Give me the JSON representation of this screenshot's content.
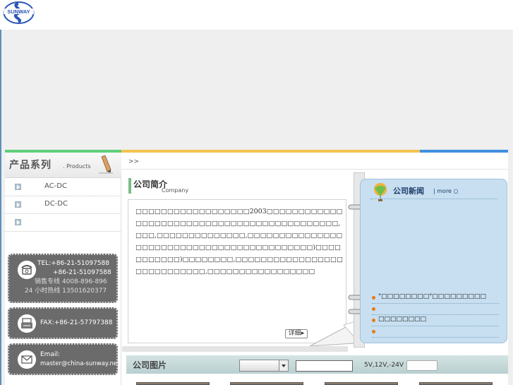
{
  "brand": {
    "logo_text": "SUNWAY"
  },
  "sidebar": {
    "title_cn": "产品系列",
    "title_en": ". Products",
    "items": [
      {
        "label": "AC-DC"
      },
      {
        "label": "DC-DC"
      },
      {
        "label": ""
      }
    ],
    "contact": {
      "tel_1": "TEL:+86-21-51097588",
      "tel_2": "+86-21-51097588",
      "sales_line": "销售专线 4008-896-896",
      "hotline": "24 小时热线  13501620377",
      "fax": "FAX:+86-21-57797388",
      "email_label": "Email:",
      "email": "master@china-sunway.net"
    }
  },
  "breadcrumb": ">>",
  "about": {
    "title_cn": "公司简介",
    "title_en": "Company",
    "text": "□□□□□□□□□□□□□□□□□□2003□□□□□□□□□□□□□□□□□□□□□□□□□□□□□□□□□□□□□□□□□□□□,□□□,□□□□□□□□□□□□□□,□□□□□□□□□□□□□□□□□□□□□□□□□□□□□□□□□□□□□□□□□□□)□□□□□□□□□□□)□□□□□□□□,□□□□□□□□□□□□□□□□□□□□□□□□□□□□,□□□□□□□□□□□□□□□□□",
    "detail_label": "详细"
  },
  "news": {
    "title": "公司新闻",
    "more": "more",
    "items": [
      {
        "text": "\"□□□□□□□□\"□□□□□□□□□"
      },
      {
        "text": ""
      },
      {
        "text": "□□□□□□□□"
      },
      {
        "text": ""
      }
    ]
  },
  "photos": {
    "title": "公司图片",
    "select_value": "",
    "search_value": "",
    "spec": "5V,12V,-24V",
    "button_label": ""
  },
  "colors": {
    "stripe_green": "#5fcf7a",
    "stripe_yellow": "#f4c24e",
    "stripe_blue": "#3f8fe0",
    "news_bg": "#c7dff0",
    "contact_card": "#6b6b6b"
  }
}
